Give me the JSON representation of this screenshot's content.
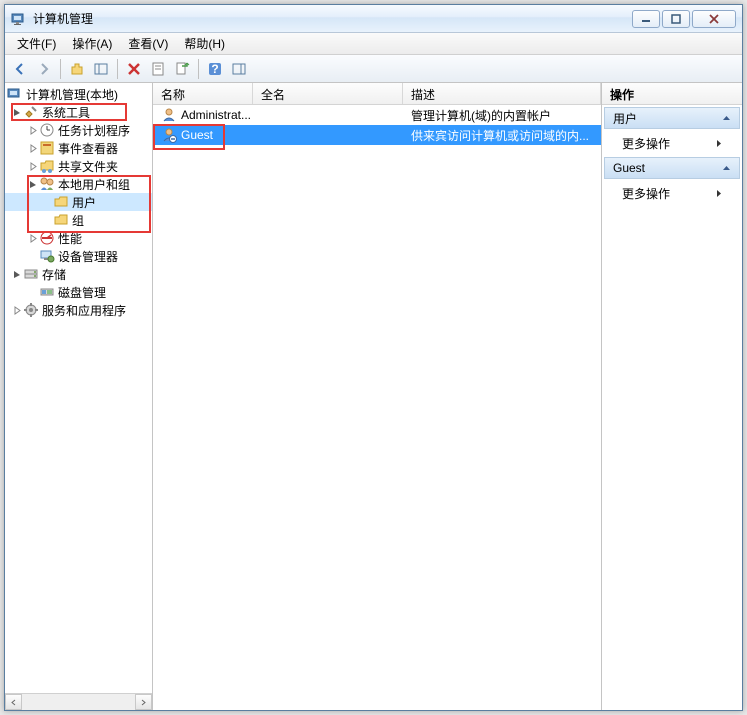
{
  "window": {
    "title": "计算机管理"
  },
  "menu": {
    "file": "文件(F)",
    "action": "操作(A)",
    "view": "查看(V)",
    "help": "帮助(H)"
  },
  "tree": {
    "root": "计算机管理(本地)",
    "system_tools": "系统工具",
    "task_scheduler": "任务计划程序",
    "event_viewer": "事件查看器",
    "shared_folders": "共享文件夹",
    "local_users_groups": "本地用户和组",
    "users": "用户",
    "groups": "组",
    "performance": "性能",
    "device_manager": "设备管理器",
    "storage": "存储",
    "disk_management": "磁盘管理",
    "services_apps": "服务和应用程序"
  },
  "list": {
    "columns": {
      "name": "名称",
      "fullname": "全名",
      "description": "描述"
    },
    "col_widths": {
      "name": 100,
      "fullname": 150,
      "description": 190
    },
    "rows": [
      {
        "name": "Administrat...",
        "fullname": "",
        "description": "管理计算机(域)的内置帐户",
        "selected": false
      },
      {
        "name": "Guest",
        "fullname": "",
        "description": "供来宾访问计算机或访问域的内...",
        "selected": true
      }
    ]
  },
  "actions": {
    "header": "操作",
    "sections": [
      {
        "title": "用户",
        "items": [
          "更多操作"
        ]
      },
      {
        "title": "Guest",
        "items": [
          "更多操作"
        ]
      }
    ]
  },
  "colors": {
    "selection": "#3399ff",
    "highlight_border": "#e53935"
  }
}
